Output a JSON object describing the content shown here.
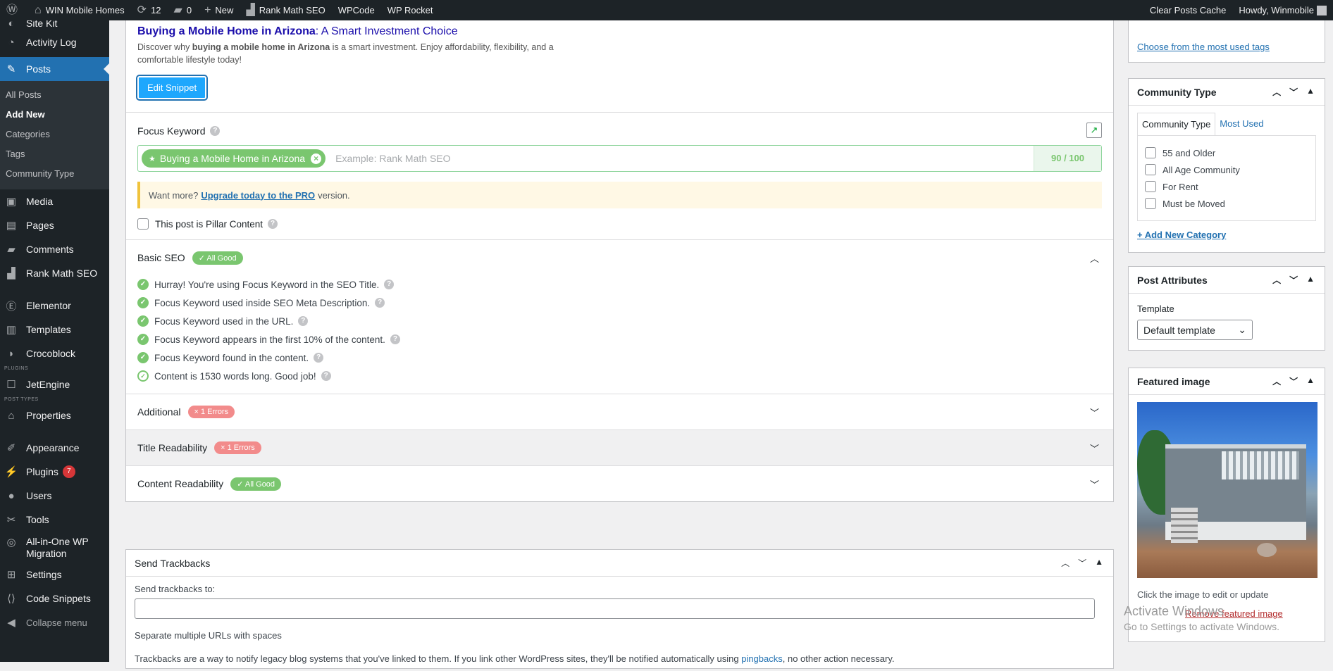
{
  "adminbar": {
    "site_name": "WIN Mobile Homes",
    "updates_count": "12",
    "comments_count": "0",
    "new_label": "New",
    "rankmath_label": "Rank Math SEO",
    "wpcode_label": "WPCode",
    "wprocket_label": "WP Rocket",
    "clear_cache_label": "Clear Posts Cache",
    "howdy_label": "Howdy, Winmobile"
  },
  "sidebar": {
    "items": [
      {
        "label": "Site Kit",
        "icon": "sitekit-icon"
      },
      {
        "label": "Activity Log",
        "icon": "activity-icon"
      },
      {
        "label": "Posts",
        "icon": "pin-icon"
      }
    ],
    "submenu": [
      "All Posts",
      "Add New",
      "Categories",
      "Tags",
      "Community Type"
    ],
    "items2": [
      {
        "label": "Media",
        "icon": "media-icon"
      },
      {
        "label": "Pages",
        "icon": "pages-icon"
      },
      {
        "label": "Comments",
        "icon": "comments-icon"
      },
      {
        "label": "Rank Math SEO",
        "icon": "rankmath-icon"
      },
      {
        "label": "Elementor",
        "icon": "elementor-icon"
      },
      {
        "label": "Templates",
        "icon": "templates-icon"
      },
      {
        "label": "Crocoblock",
        "icon": "crocoblock-icon"
      }
    ],
    "sep_plugins": "PLUGINS",
    "jetengine": "JetEngine",
    "sep_post_types": "POST TYPES",
    "properties": "Properties",
    "appearance": "Appearance",
    "plugins": "Plugins",
    "plugins_badge": "7",
    "users": "Users",
    "tools": "Tools",
    "migration_1": "All-in-One WP",
    "migration_2": "Migration",
    "settings": "Settings",
    "code_snippets": "Code Snippets",
    "collapse": "Collapse menu"
  },
  "snippet": {
    "title_bold": "Buying a Mobile Home in Arizona",
    "title_rest": ": A Smart Investment Choice",
    "desc_pre": "Discover why ",
    "desc_bold": "buying a mobile home in Arizona",
    "desc_post": " is a smart investment. Enjoy affordability, flexibility, and a comfortable lifestyle today!",
    "edit_button": "Edit Snippet"
  },
  "focus": {
    "label": "Focus Keyword",
    "keyword": "Buying a Mobile Home in Arizona",
    "placeholder": "Example: Rank Math SEO",
    "score": "90 / 100",
    "notice_pre": "Want more?",
    "notice_link": "Upgrade today to the PRO",
    "notice_post": "version.",
    "pillar_label": "This post is Pillar Content"
  },
  "basic_seo": {
    "title": "Basic SEO",
    "badge": "✓ All Good",
    "tests": [
      "Hurray! You're using Focus Keyword in the SEO Title.",
      "Focus Keyword used inside SEO Meta Description.",
      "Focus Keyword used in the URL.",
      "Focus Keyword appears in the first 10% of the content.",
      "Focus Keyword found in the content.",
      "Content is 1530 words long. Good job!"
    ]
  },
  "additional": {
    "title": "Additional",
    "badge": "× 1 Errors"
  },
  "title_readability": {
    "title": "Title Readability",
    "badge": "× 1 Errors"
  },
  "content_readability": {
    "title": "Content Readability",
    "badge": "✓ All Good"
  },
  "trackbacks": {
    "title": "Send Trackbacks",
    "label": "Send trackbacks to:",
    "hint": "Separate multiple URLs with spaces",
    "desc_pre": "Trackbacks are a way to notify legacy blog systems that you've linked to them. If you link other WordPress sites, they'll be notified automatically using ",
    "desc_link": "pingbacks",
    "desc_post": ", no other action necessary."
  },
  "tags_box": {
    "link": "Choose from the most used tags"
  },
  "community_box": {
    "title": "Community Type",
    "tab_active": "Community Type",
    "tab_inactive": "Most Used",
    "options": [
      "55 and Older",
      "All Age Community",
      "For Rent",
      "Must be Moved"
    ],
    "add_new": "+ Add New Category"
  },
  "attributes_box": {
    "title": "Post Attributes",
    "template_label": "Template",
    "template_value": "Default template"
  },
  "featured_box": {
    "title": "Featured image",
    "hint": "Click the image to edit or update",
    "remove": "Remove featured image"
  },
  "watermark": {
    "line1": "Activate Windows",
    "line2": "Go to Settings to activate Windows."
  }
}
